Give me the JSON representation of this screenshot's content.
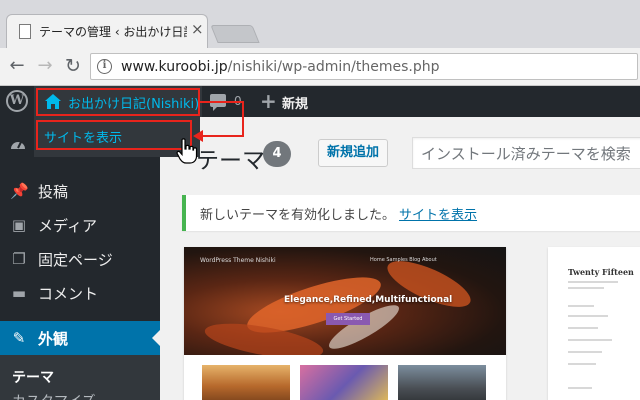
{
  "browser": {
    "tab_title": "テーマの管理 ‹ お出かけ日記",
    "tab_close": "×",
    "url_domain": "www.kuroobi.jp",
    "url_path": "/nishiki/wp-admin/themes.php"
  },
  "admin_bar": {
    "site_name": "お出かけ日記(Nishiki)",
    "comment_count": "0",
    "new_label": "新規",
    "dropdown_view_site": "サイトを表示"
  },
  "sidebar": {
    "items": [
      {
        "label": "投稿",
        "icon": "pin-icon"
      },
      {
        "label": "メディア",
        "icon": "media-icon"
      },
      {
        "label": "固定ページ",
        "icon": "pages-icon"
      },
      {
        "label": "コメント",
        "icon": "comment-icon"
      },
      {
        "label": "外観",
        "icon": "appearance-icon"
      }
    ],
    "submenu": [
      "テーマ",
      "カスタマイズ"
    ]
  },
  "main": {
    "title": "テーマ",
    "theme_count": "4",
    "add_new": "新規追加",
    "search_placeholder": "インストール済みテーマを検索",
    "notice": "新しいテーマを有効化しました。",
    "notice_link": "サイトを表示"
  },
  "theme_preview": {
    "brand": "WordPress Theme Nishiki",
    "nav": "Home  Samples  Blog  About",
    "tagline": "Elegance,Refined,Multifunctional",
    "button": "Get Started",
    "twentyfifteen_title": "Twenty Fifteen"
  },
  "colors": {
    "admin_bar": "#23282d",
    "accent_blue": "#0073aa",
    "link_blue": "#00b9eb",
    "notice_green": "#46b450",
    "annotation_red": "#e8241c"
  }
}
